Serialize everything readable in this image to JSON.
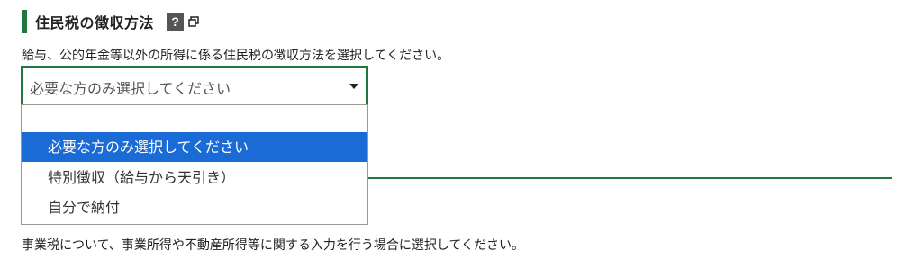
{
  "section": {
    "title": "住民税の徴収方法",
    "help_label": "?",
    "description": "給与、公的年金等以外の所得に係る住民税の徴収方法を選択してください。"
  },
  "select": {
    "current_value": "必要な方のみ選択してください",
    "options": [
      "",
      "必要な方のみ選択してください",
      "特別徴収（給与から天引き）",
      "自分で納付"
    ],
    "selected_index": 1
  },
  "next_section": {
    "description": "事業税について、事業所得や不動産所得等に関する入力を行う場合に選択してください。"
  },
  "colors": {
    "accent": "#1e7a3c",
    "highlight": "#1a6bd6"
  }
}
